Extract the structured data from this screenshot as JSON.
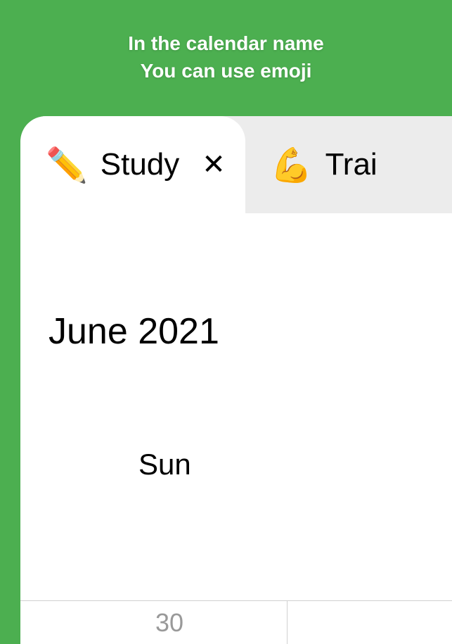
{
  "header": {
    "line1": "In the calendar name",
    "line2": "You can use emoji"
  },
  "tabs": [
    {
      "emoji": "✏️",
      "label": "Study",
      "active": true
    },
    {
      "emoji": "💪",
      "label": "Trai",
      "active": false
    }
  ],
  "calendar": {
    "month_title": "June 2021",
    "day_headers": [
      "Sun"
    ],
    "prev_month_day": "30"
  }
}
